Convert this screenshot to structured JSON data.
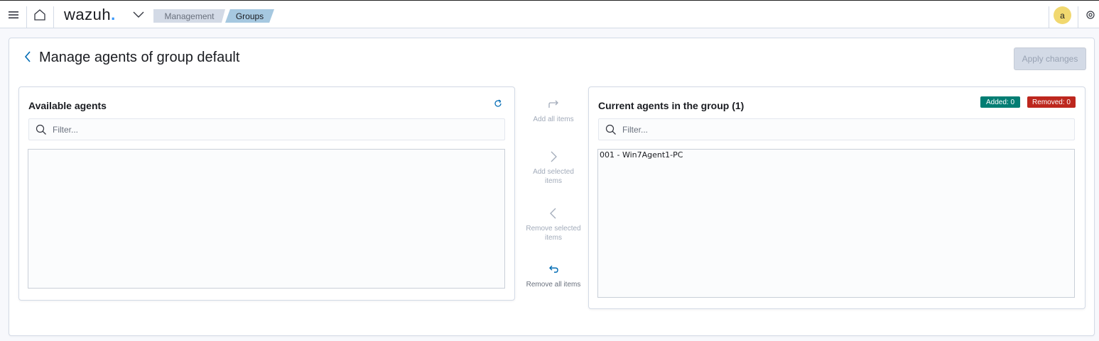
{
  "header": {
    "logo_text": "wazuh",
    "logo_dot": ".",
    "breadcrumb": [
      "Management",
      "Groups"
    ],
    "user_initial": "a",
    "accent_color": "#3595f9"
  },
  "page": {
    "title": "Manage agents of group default",
    "apply_label": "Apply changes"
  },
  "available": {
    "title": "Available agents",
    "filter_placeholder": "Filter...",
    "items": []
  },
  "actions": {
    "add_all": "Add all items",
    "add_selected": "Add selected items",
    "remove_selected": "Remove selected items",
    "remove_all": "Remove all items"
  },
  "current": {
    "title": "Current agents in the group (1)",
    "added_badge": "Added: 0",
    "removed_badge": "Removed: 0",
    "filter_placeholder": "Filter...",
    "items": [
      "001 - Win7Agent1-PC"
    ]
  },
  "icons": {
    "menu": "hamburger-icon",
    "home": "home-icon",
    "chevron": "chevron-down-icon",
    "help": "help-icon",
    "back": "arrow-left-icon",
    "refresh": "refresh-icon",
    "search": "search-icon"
  }
}
